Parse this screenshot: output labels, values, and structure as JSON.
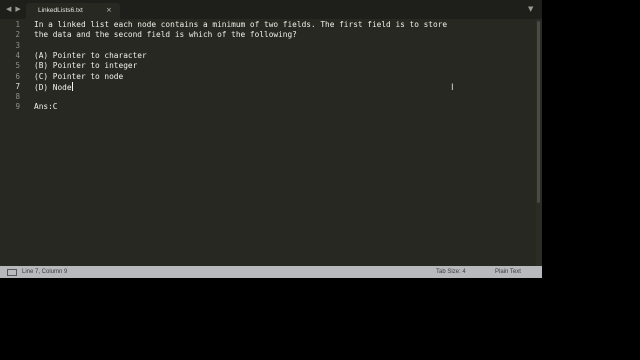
{
  "tab": {
    "title": "LinkedLists6.txt",
    "close_glyph": "×"
  },
  "toolbar": {
    "back_icon": "chevron-left-icon",
    "forward_icon": "chevron-right-icon",
    "dropdown_icon": "chevron-down-icon"
  },
  "editor": {
    "line_numbers": [
      "1",
      "2",
      "3",
      "4",
      "5",
      "6",
      "7",
      "8",
      "9"
    ],
    "lines": [
      "In a linked list each node contains a minimum of two fields. The first field is to store",
      "the data and the second field is which of the following?",
      "",
      "(A) Pointer to character",
      "(B) Pointer to integer",
      "(C) Pointer to node",
      "(D) Node",
      "",
      "Ans:C"
    ],
    "cursor_line": 7
  },
  "statusbar": {
    "position": "Line 7, Column 9",
    "tab_size": "Tab Size: 4",
    "syntax": "Plain Text"
  },
  "colors": {
    "background": "#272822",
    "text": "#f8f8f2",
    "statusbar": "#b8b9bd"
  }
}
